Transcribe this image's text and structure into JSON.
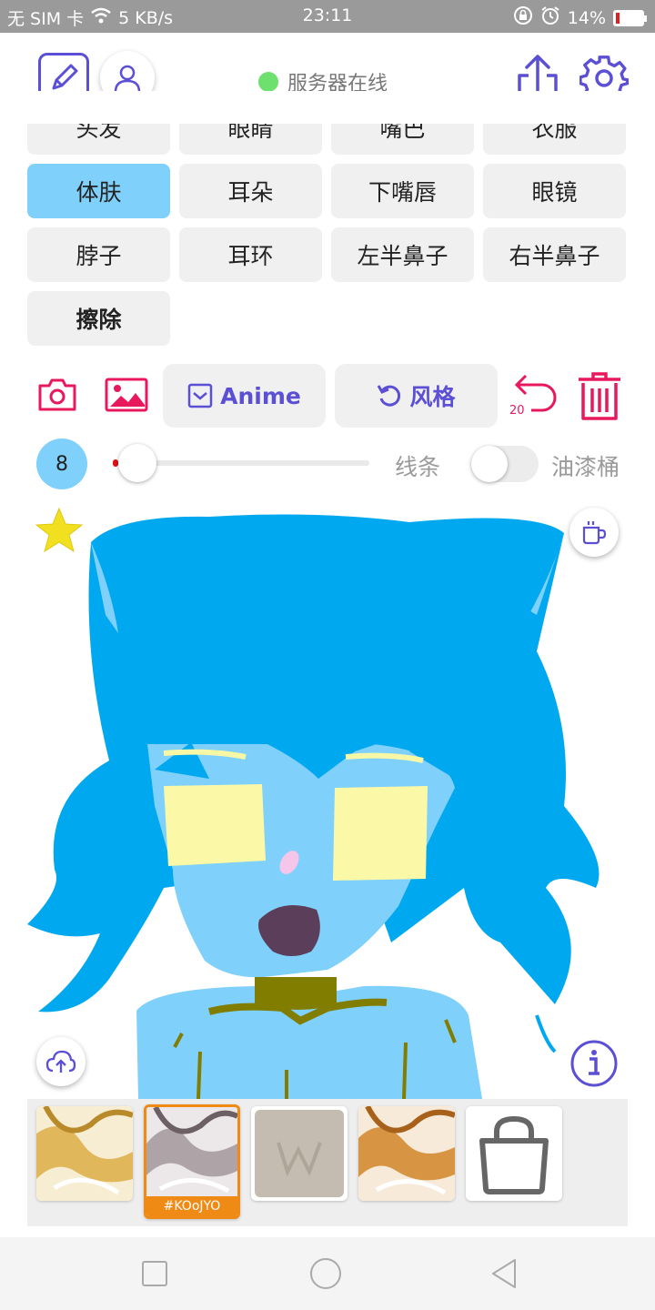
{
  "statusbar": {
    "carrier": "无 SIM 卡",
    "net_speed": "5 KB/s",
    "time": "23:11",
    "battery": "14%",
    "battery_level": 0.14
  },
  "header": {
    "server_status": "服务器在线",
    "server_color": "#6de06d"
  },
  "categories": {
    "row0": [
      "头发",
      "眼睛",
      "嘴巴",
      "衣服"
    ],
    "row1": [
      "体肤",
      "耳朵",
      "下嘴唇",
      "眼镜"
    ],
    "row2": [
      "脖子",
      "耳环",
      "左半鼻子",
      "右半鼻子"
    ],
    "row3": [
      "擦除"
    ],
    "active": "体肤"
  },
  "toolbar": {
    "anime_label": "Anime",
    "style_label": "风格",
    "undo_count": "20"
  },
  "brush": {
    "size": "8",
    "slider_level": 0.0,
    "line_label": "线条",
    "bucket_label": "油漆桶",
    "bucket_on": false
  },
  "gallery": {
    "selected_tag": "#KOoJYO"
  },
  "colors": {
    "accent": "#5b4fd6",
    "pink": "#e8185c",
    "skin": "#7fd0fb",
    "hair": "#00a8f0",
    "tag": "#ef8a14"
  }
}
